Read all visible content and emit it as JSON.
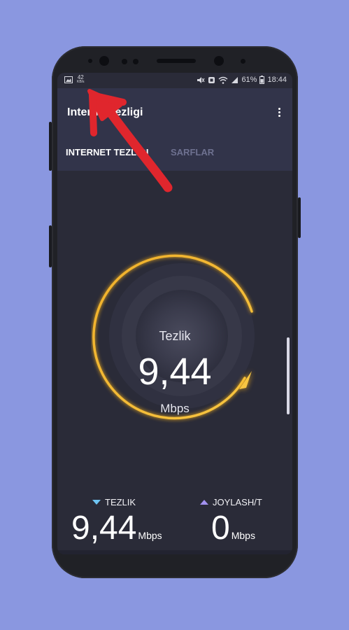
{
  "status_bar": {
    "left_icons": [
      "image-icon",
      "data-speed-icon"
    ],
    "speed_value": "42",
    "speed_unit": "KB/s",
    "battery_pct": "61%",
    "time": "18:44"
  },
  "app": {
    "title": "Internet tezligi",
    "tabs": [
      {
        "label": "INTERNET TEZLIGI",
        "active": true
      },
      {
        "label": "SARFLAR",
        "active": false
      }
    ]
  },
  "gauge": {
    "title": "Tezlik",
    "value": "9,44",
    "unit": "Mbps",
    "arc_color": "#f7b21b"
  },
  "stats": {
    "download": {
      "label": "TEZLIK",
      "value": "9,44",
      "unit": "Mbps",
      "icon": "triangle-down-icon"
    },
    "upload": {
      "label": "JOYLASH/T",
      "value": "0",
      "unit": "Mbps",
      "icon": "triangle-up-icon"
    }
  },
  "colors": {
    "page_background": "#8a97e0",
    "screen_background": "#2a2b38",
    "annotation_arrow": "#e0262d"
  }
}
